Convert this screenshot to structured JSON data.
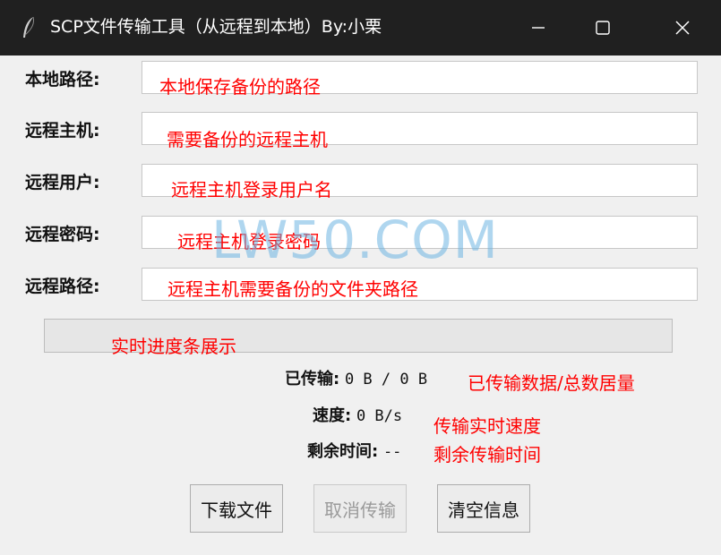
{
  "window": {
    "title": "SCP文件传输工具（从远程到本地）By:小栗",
    "icon": "feather-icon"
  },
  "fields": [
    {
      "label": "本地路径:",
      "value": "",
      "annotation": "本地保存备份的路径"
    },
    {
      "label": "远程主机:",
      "value": "",
      "annotation": "需要备份的远程主机"
    },
    {
      "label": "远程用户:",
      "value": "",
      "annotation": "远程主机登录用户名"
    },
    {
      "label": "远程密码:",
      "value": "",
      "annotation": "远程主机登录密码"
    },
    {
      "label": "远程路径:",
      "value": "",
      "annotation": "远程主机需要备份的文件夹路径"
    }
  ],
  "progress": {
    "value": 0,
    "annotation": "实时进度条展示"
  },
  "stats": {
    "transferred_label": "已传输:",
    "transferred_value": "0 B / 0 B",
    "transferred_annotation": "已传输数据/总数居量",
    "speed_label": "速度:",
    "speed_value": "0 B/s",
    "speed_annotation": "传输实时速度",
    "remaining_label": "剩余时间:",
    "remaining_value": "--",
    "remaining_annotation": "剩余传输时间"
  },
  "buttons": {
    "download": "下载文件",
    "cancel": "取消传输",
    "clear": "清空信息"
  },
  "watermark": "LW50.COM",
  "colors": {
    "titlebar": "#202020",
    "annotation": "#ff0000",
    "background": "#f0f0f0"
  }
}
